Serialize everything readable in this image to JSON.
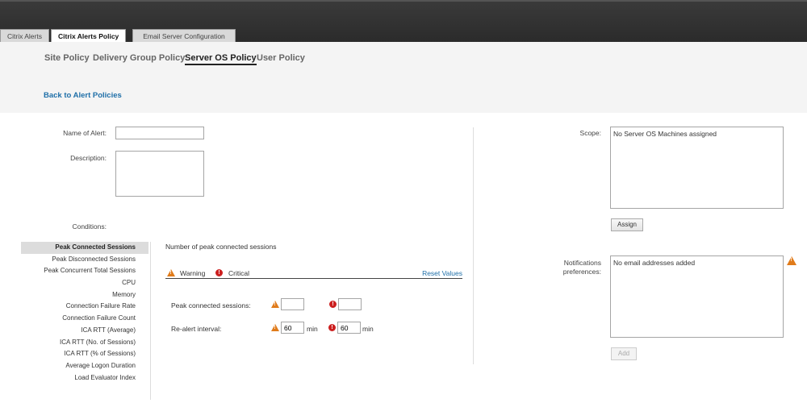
{
  "tabs": [
    {
      "label": "Citrix Alerts"
    },
    {
      "label": "Citrix Alerts Policy"
    },
    {
      "label": "Email Server Configuration"
    }
  ],
  "policy_nav": [
    {
      "label": "Site Policy"
    },
    {
      "label": "Delivery Group Policy"
    },
    {
      "label": "Server OS Policy"
    },
    {
      "label": "User Policy"
    }
  ],
  "back_link": "Back to Alert Policies",
  "form": {
    "name_label": "Name of Alert:",
    "name_value": "",
    "description_label": "Description:",
    "description_value": "",
    "conditions_label": "Conditions:"
  },
  "conditions": [
    "Peak Connected Sessions",
    "Peak Disconnected Sessions",
    "Peak Concurrent Total Sessions",
    "CPU",
    "Memory",
    "Connection Failure Rate",
    "Connection Failure Count",
    "ICA RTT (Average)",
    "ICA RTT (No. of Sessions)",
    "ICA RTT (% of Sessions)",
    "Average Logon Duration",
    "Load Evaluator Index"
  ],
  "selected_condition": "Peak Connected Sessions",
  "detail": {
    "title": "Number of peak connected sessions",
    "warning_label": "Warning",
    "critical_label": "Critical",
    "reset_label": "Reset Values",
    "peak_label": "Peak connected sessions:",
    "peak_warning_value": "",
    "peak_critical_value": "",
    "realert_label": "Re-alert interval:",
    "realert_warning_value": "60",
    "realert_critical_value": "60",
    "unit_min": "min"
  },
  "scope": {
    "label": "Scope:",
    "value": "No Server OS Machines assigned",
    "assign_button": "Assign"
  },
  "notifications": {
    "label_line1": "Notifications",
    "label_line2": "preferences:",
    "value": "No email addresses added",
    "add_button": "Add"
  },
  "colors": {
    "link": "#1f6fa8",
    "warning": "#e07b1a",
    "critical": "#cc1f1f"
  }
}
